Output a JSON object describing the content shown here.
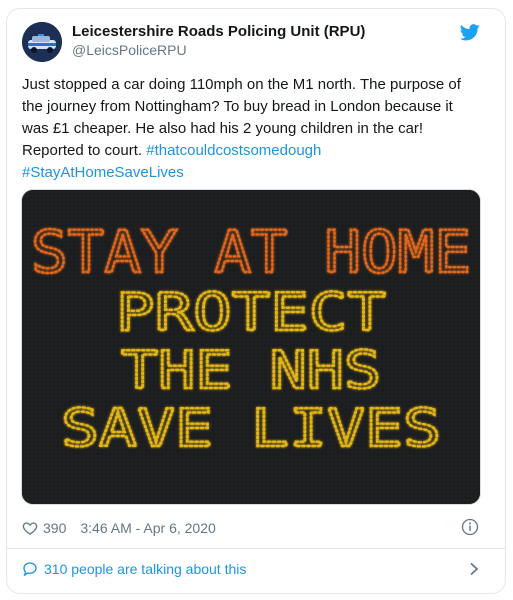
{
  "tweet": {
    "author_name": "Leicestershire Roads Policing Unit (RPU)",
    "author_handle": "@LeicsPoliceRPU",
    "text_plain": "Just stopped a car doing 110mph on the M1 north. The purpose of the journey from Nottingham? To buy bread in London because it was £1 cheaper. He also had his 2 young children in the car! Reported to court. ",
    "hashtags": [
      "#thatcouldcostsomedough",
      "#StayAtHomeSaveLives"
    ],
    "likes": "390",
    "timestamp": "3:46 AM - Apr 6, 2020",
    "talking": "310 people are talking about this"
  },
  "media": {
    "sign_lines": [
      "STAY AT HOME",
      "PROTECT",
      "THE NHS",
      "SAVE LIVES"
    ],
    "line_colors": [
      "#e0671c",
      "#e2b515",
      "#e2b515",
      "#e2b515"
    ]
  },
  "icons": {
    "brand": "twitter-bird-icon",
    "like": "heart-icon",
    "info": "info-icon",
    "talking": "speech-bubble-icon",
    "more": "chevron-right-icon"
  },
  "colors": {
    "accent": "#1b95e0",
    "muted": "#657786",
    "border": "#e1e8ed"
  }
}
